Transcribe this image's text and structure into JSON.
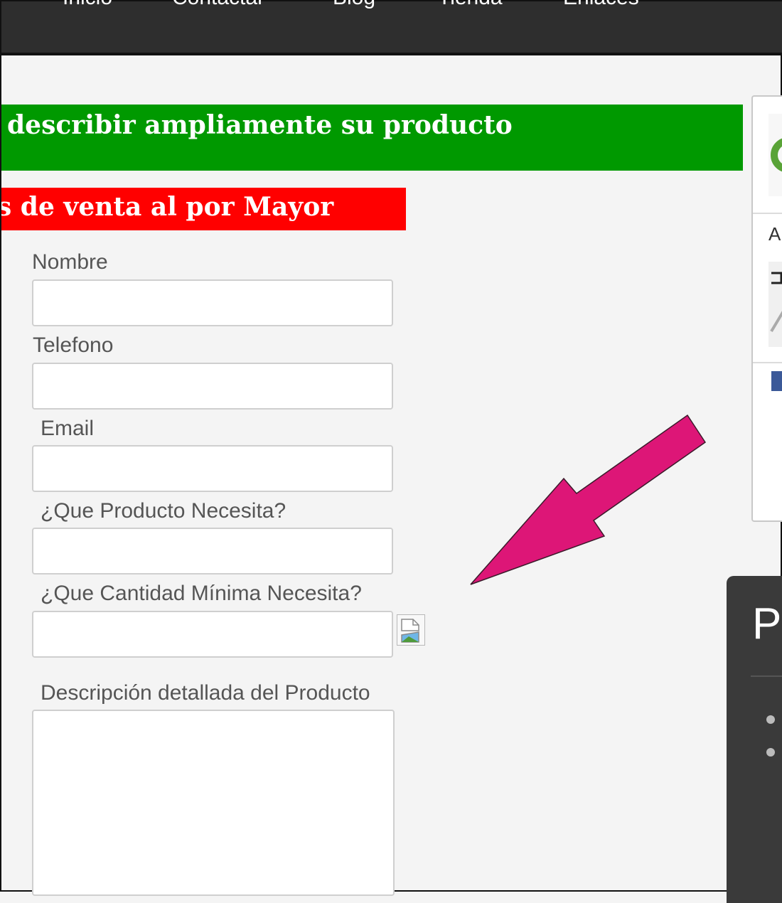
{
  "nav": {
    "items": [
      {
        "label": "Inicio"
      },
      {
        "label": "Contactar"
      },
      {
        "label": "Blog"
      },
      {
        "label": "Tienda"
      },
      {
        "label": "Enlaces"
      }
    ]
  },
  "banner_green": {
    "text": "describir ampliamente su producto"
  },
  "banner_red": {
    "text": "s de venta al por Mayor"
  },
  "form": {
    "fields": [
      {
        "label": "Nombre",
        "value": ""
      },
      {
        "label": "Telefono",
        "value": ""
      },
      {
        "label": "Email",
        "value": ""
      },
      {
        "label": "¿Que Producto Necesita?",
        "value": ""
      },
      {
        "label": "¿Que Cantidad Mínima Necesita?",
        "value": ""
      }
    ],
    "description": {
      "label": "Descripción detallada del Producto",
      "value": ""
    }
  },
  "sidebar": {
    "text_a": "A"
  },
  "dark_panel": {
    "title": "P"
  },
  "colors": {
    "nav_bg": "#2e2e2e",
    "green_banner": "#009900",
    "red_banner": "#ff0000",
    "arrow": "#dd1677"
  }
}
